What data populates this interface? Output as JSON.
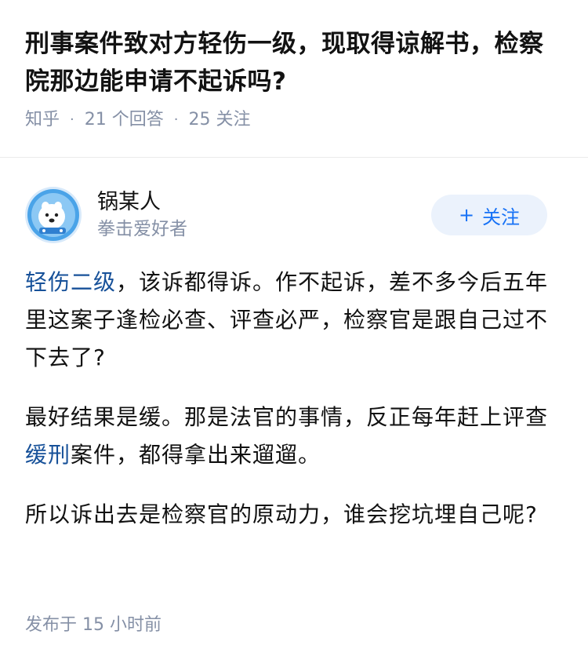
{
  "question": {
    "title": "刑事案件致对方轻伤一级，现取得谅解书，检察院那边能申请不起诉吗?",
    "source": "知乎",
    "answers": "21 个回答",
    "followers": "25 关注"
  },
  "author": {
    "name": "锅某人",
    "bio": "拳击爱好者",
    "follow_label": "关注",
    "follow_icon": "plus-icon"
  },
  "answer": {
    "p1_link": "轻伤二级",
    "p1_text": "，该诉都得诉。作不起诉，差不多今后五年里这案子逢检必查、评查必严，检察官是跟自己过不下去了?",
    "p2_pre": "最好结果是缓。那是法官的事情，反正每年赶上评查",
    "p2_link": "缓刑",
    "p2_post": "案件，都得拿出来遛遛。",
    "p3_text": "所以诉出去是检察官的原动力，谁会挖坑埋自己呢?"
  },
  "footer": {
    "published": "发布于  15 小时前"
  },
  "colors": {
    "link": "#175199",
    "accent": "#1772f6",
    "meta": "#8590a6"
  }
}
